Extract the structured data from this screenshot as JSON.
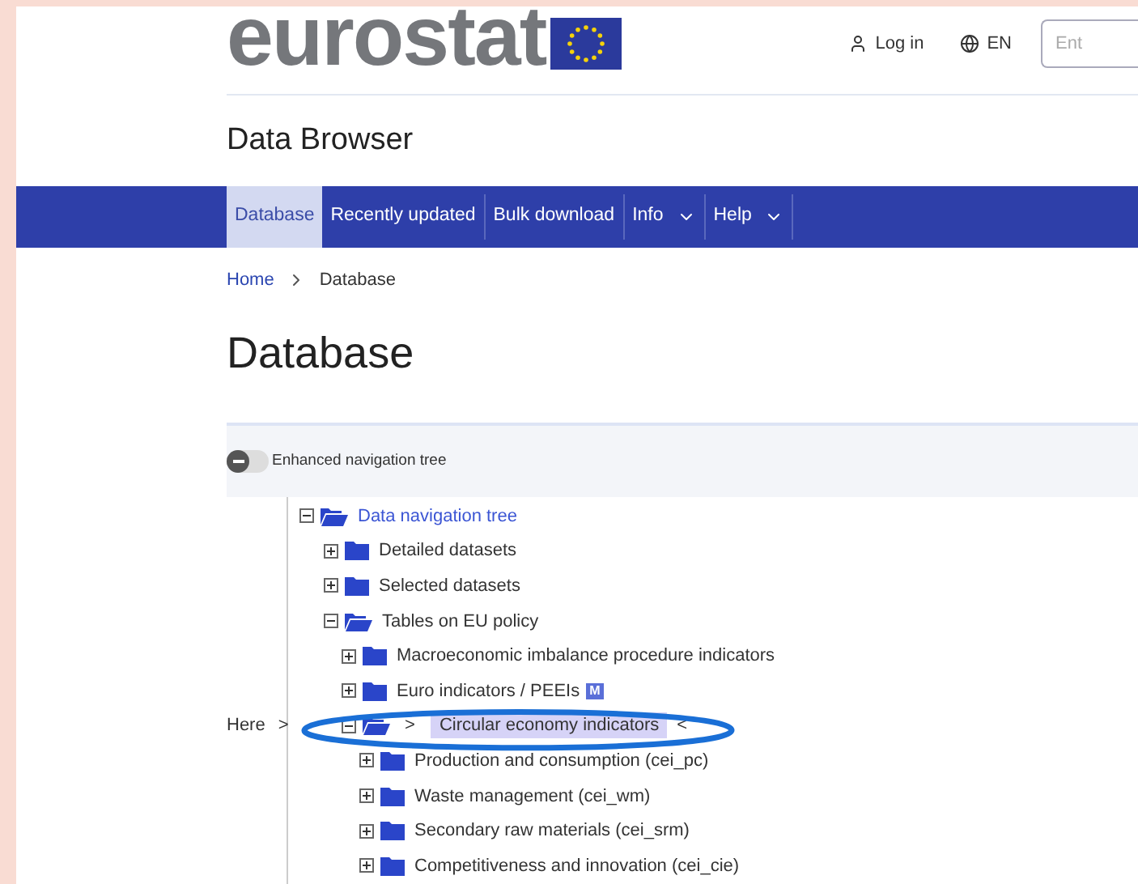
{
  "header": {
    "logo_text": "eurostat",
    "login": "Log in",
    "language": "EN",
    "search": {
      "placeholder": "Ent"
    }
  },
  "site_title": "Data Browser",
  "nav": [
    {
      "label": "Database",
      "selected": true,
      "dropdown": false
    },
    {
      "label": "Recently updated",
      "selected": false,
      "dropdown": false
    },
    {
      "label": "Bulk download",
      "selected": false,
      "dropdown": false
    },
    {
      "label": "Info",
      "selected": false,
      "dropdown": true
    },
    {
      "label": "Help",
      "selected": false,
      "dropdown": true
    }
  ],
  "breadcrumb": [
    {
      "label": "Home",
      "kind": "link"
    },
    {
      "label": "Database",
      "kind": "current"
    }
  ],
  "heading": "Database",
  "toggle": {
    "label": "Enhanced navigation tree",
    "on": false
  },
  "pointer": {
    "text": "Here",
    "arrow": ">"
  },
  "tree": [
    {
      "label": "Data navigation tree",
      "expanded": true,
      "selected": false,
      "children": [
        {
          "label": "Detailed datasets",
          "expanded": false,
          "selected": false
        },
        {
          "label": "Selected datasets",
          "expanded": false,
          "selected": false
        },
        {
          "label": "Tables on EU policy",
          "expanded": true,
          "selected": false,
          "children": [
            {
              "label": "Macroeconomic imbalance procedure indicators",
              "expanded": false,
              "selected": false
            },
            {
              "label": "Euro indicators / PEEIs",
              "expanded": false,
              "selected": false,
              "badge": "M"
            },
            {
              "label": "Circular economy indicators",
              "expanded": true,
              "selected": true,
              "markers": [
                ">",
                "<"
              ],
              "children": [
                {
                  "label": "Production and consumption (cei_pc)",
                  "expanded": false,
                  "selected": false
                },
                {
                  "label": "Waste management (cei_wm)",
                  "expanded": false,
                  "selected": false
                },
                {
                  "label": "Secondary raw materials (cei_srm)",
                  "expanded": false,
                  "selected": false
                },
                {
                  "label": "Competitiveness and innovation (cei_cie)",
                  "expanded": false,
                  "selected": false
                }
              ]
            }
          ]
        }
      ]
    }
  ]
}
